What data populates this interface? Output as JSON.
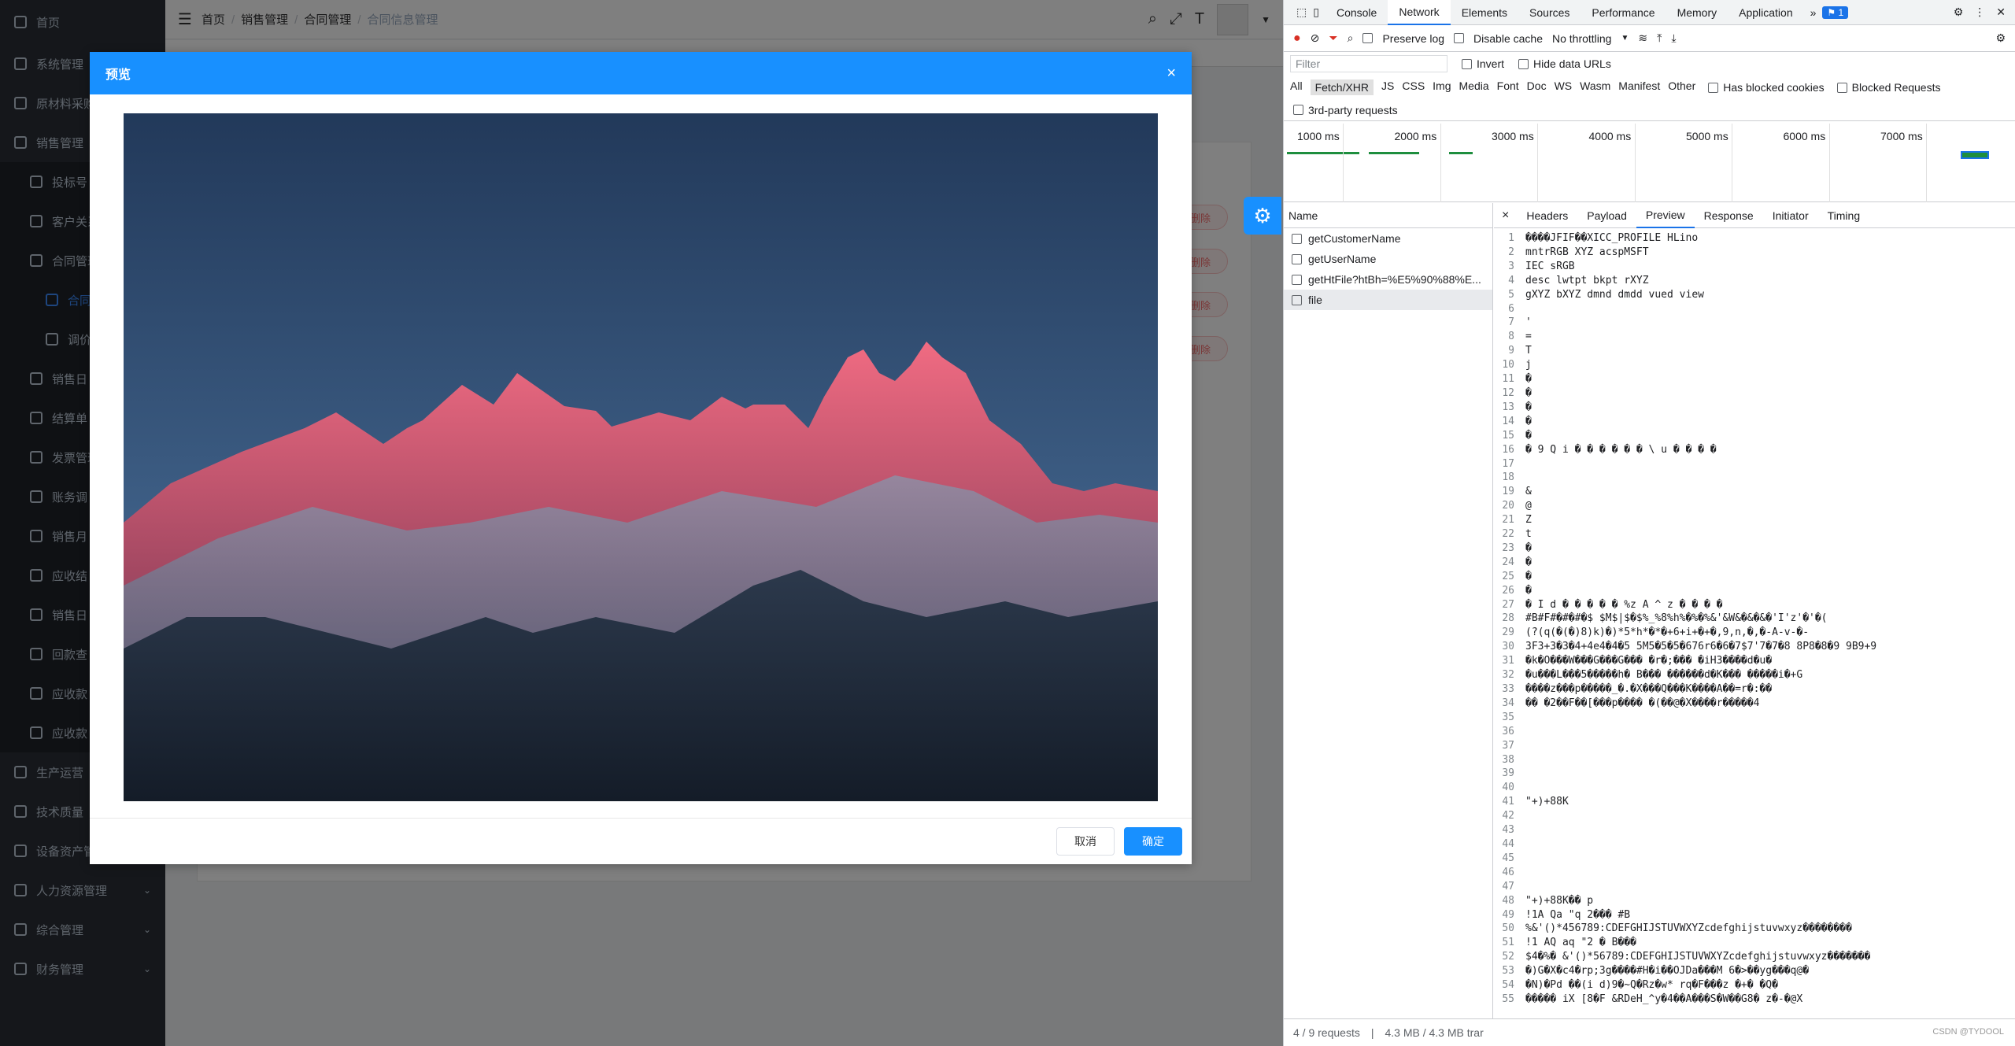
{
  "sidebar": {
    "items": [
      {
        "label": "首页"
      },
      {
        "label": "系统管理"
      },
      {
        "label": "原材料采购"
      },
      {
        "label": "销售管理"
      },
      {
        "label": "投标号"
      },
      {
        "label": "客户关系"
      },
      {
        "label": "合同管理"
      },
      {
        "label": "合同"
      },
      {
        "label": "调价"
      },
      {
        "label": "销售日"
      },
      {
        "label": "结算单"
      },
      {
        "label": "发票管理"
      },
      {
        "label": "账务调"
      },
      {
        "label": "销售月"
      },
      {
        "label": "应收结"
      },
      {
        "label": "销售日"
      },
      {
        "label": "回款查"
      },
      {
        "label": "应收款"
      },
      {
        "label": "应收款"
      },
      {
        "label": "生产运营"
      },
      {
        "label": "技术质量"
      },
      {
        "label": "设备资产管理"
      },
      {
        "label": "人力资源管理"
      },
      {
        "label": "综合管理"
      },
      {
        "label": "财务管理"
      }
    ]
  },
  "header": {
    "breadcrumb": [
      "首页",
      "销售管理",
      "合同管理",
      "合同信息管理"
    ]
  },
  "table": {
    "delete_label": "删除"
  },
  "dialog": {
    "title": "预览",
    "close": "×",
    "cancel_label": "取消",
    "confirm_label": "确定"
  },
  "devtools": {
    "tabs": [
      "Console",
      "Network",
      "Elements",
      "Sources",
      "Performance",
      "Memory",
      "Application"
    ],
    "active_tab": "Network",
    "issues_count": "1",
    "toolbar": {
      "preserve_log": "Preserve log",
      "disable_cache": "Disable cache",
      "throttling": "No throttling"
    },
    "filter": {
      "placeholder": "Filter",
      "invert": "Invert",
      "hide_data_urls": "Hide data URLs"
    },
    "types": [
      "All",
      "Fetch/XHR",
      "JS",
      "CSS",
      "Img",
      "Media",
      "Font",
      "Doc",
      "WS",
      "Wasm",
      "Manifest",
      "Other"
    ],
    "blocked_cookies": "Has blocked cookies",
    "blocked_requests": "Blocked Requests",
    "third_party": "3rd-party requests",
    "timeline_ticks": [
      "1000 ms",
      "2000 ms",
      "3000 ms",
      "4000 ms",
      "5000 ms",
      "6000 ms",
      "7000 ms"
    ],
    "name_header": "Name",
    "requests": [
      "getCustomerName",
      "getUserName",
      "getHtFile?htBh=%E5%90%88%E...",
      "file"
    ],
    "detail_tabs": [
      "Headers",
      "Payload",
      "Preview",
      "Response",
      "Initiator",
      "Timing"
    ],
    "detail_close": "×",
    "preview_lines": [
      "����JFIF��XICC_PROFILE HLino",
      "mntrRGB XYZ acspMSFT",
      "IEC sRGB",
      "desc lwtpt bkpt rXYZ",
      "gXYZ bXYZ dmnd dmdd vued view",
      "",
      "'",
      "=",
      "T",
      "j",
      "�",
      "�",
      "�",
      "�",
      "�",
      "� 9 Q i � � � � � � \\ u � � � �",
      "",
      "",
      "&",
      "@",
      "Z",
      "t",
      "�",
      "�",
      "�",
      "�",
      "� I d � � � � � %z A ^ z � � � �",
      "#B#F#�#�#�$ $M$|$�$%_%8%h%�%�%&'&W&�&�&�'I'z'�'�(",
      "(?(q(�(�)8)k)�)*5*h*�*�+6+i+�+�,9,n,�,�-A-v-�-",
      "3F3+3�3�4+4e4�4�5 5M5�5�5�676r6�6�7$7'7�7�8 8P8�8�9 9B9+9",
      "�k�O���W���G���G��� �r�;��� �iH3����d�u�",
      "�u���L���5�����h� B��� ������d�K��� �����i�+G",
      "����z���p�����_�.�X���Q���K����A��=r�:��",
      "�� �2��F��[���p���� �(��@�X����r�����4",
      "",
      "",
      "",
      "",
      "",
      "",
      "\"+)+88K",
      "",
      "",
      "",
      "",
      "",
      "",
      "\"+)+88K�� p",
      "!1A Qa \"q 2��� #B",
      "%&'()*456789:CDEFGHIJSTUVWXYZcdefghijstuvwxyz��������",
      "!1 AQ aq \"2 � B���",
      "$4�%� &'()*56789:CDEFGHIJSTUVWXYZcdefghijstuvwxyz�������",
      "�)G�X�c4�rp;3g����#H�i��OJDa���M 6�>��yg���q@�",
      "�N)�Pd ��(i d)9�~Q�Rz�w* rq�F���z �+�  �Q�",
      "����� iX [8�F &RDeH_^y�4��A���S�W��G8� z�-�@X"
    ],
    "status": {
      "requests": "4 / 9 requests",
      "transferred": "4.3 MB / 4.3 MB trar"
    },
    "watermark": "CSDN @TYDOOL"
  }
}
